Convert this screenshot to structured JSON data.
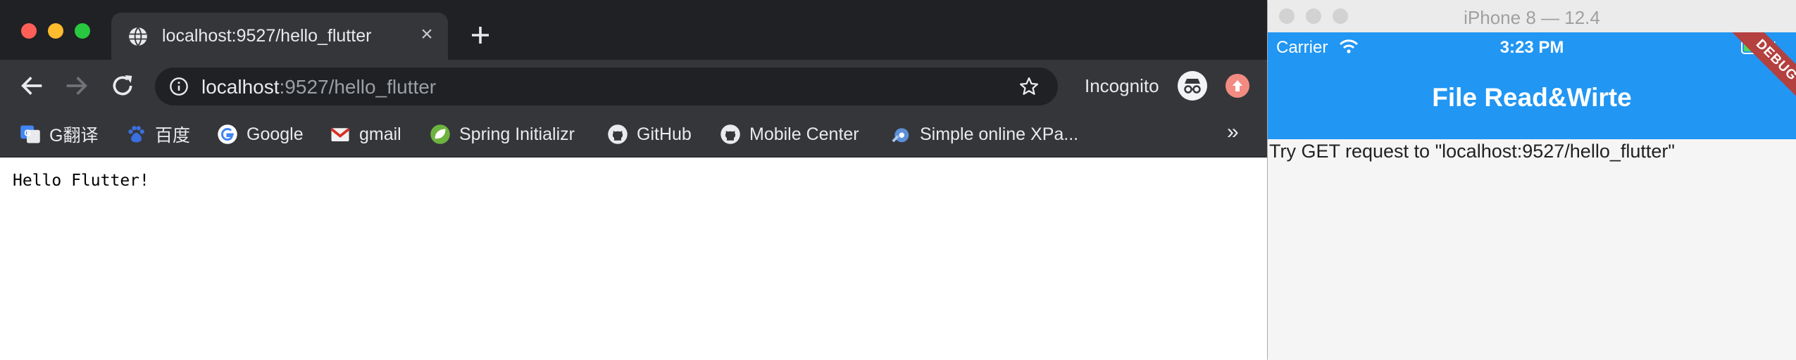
{
  "browser": {
    "tab": {
      "title": "localhost:9527/hello_flutter",
      "icon": "globe-icon"
    },
    "omnibox": {
      "host": "localhost",
      "path": ":9527/hello_flutter"
    },
    "incognito_label": "Incognito",
    "bookmarks": [
      {
        "label": "G翻译",
        "icon": "google-translate-icon"
      },
      {
        "label": "百度",
        "icon": "baidu-icon"
      },
      {
        "label": "Google",
        "icon": "google-icon"
      },
      {
        "label": "gmail",
        "icon": "gmail-icon"
      },
      {
        "label": "Spring Initializr",
        "icon": "spring-icon"
      },
      {
        "label": "GitHub",
        "icon": "github-icon"
      },
      {
        "label": "Mobile Center",
        "icon": "github-icon"
      },
      {
        "label": "Simple online XPa...",
        "icon": "xpath-icon"
      }
    ],
    "bookmarks_more": "»",
    "page_text": "Hello Flutter!"
  },
  "simulator": {
    "title": "iPhone 8 — 12.4",
    "status": {
      "carrier": "Carrier",
      "time": "3:23 PM"
    },
    "appbar_title": "File Read&Wirte",
    "debug_banner": "DEBUG",
    "body_text": "Try GET request to \"localhost:9527/hello_flutter\""
  },
  "colors": {
    "chrome_dark": "#202124",
    "chrome_toolbar": "#35363a",
    "flutter_blue": "#2196f3",
    "debug_red": "#b4403f"
  }
}
